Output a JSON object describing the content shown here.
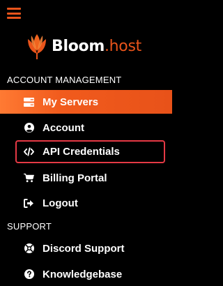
{
  "brand": {
    "name": "Bloom",
    "tld": ".host"
  },
  "colors": {
    "accent": "#e9541b",
    "active_bg": "#f15b1d",
    "highlight_border": "#e53945"
  },
  "sections": {
    "account_management": "ACCOUNT MANAGEMENT",
    "support": "SUPPORT"
  },
  "nav": {
    "my_servers": {
      "label": "My Servers",
      "icon": "server-icon"
    },
    "account": {
      "label": "Account",
      "icon": "user-circle-icon"
    },
    "api_credentials": {
      "label": "API Credentials",
      "icon": "code-icon"
    },
    "billing_portal": {
      "label": "Billing Portal",
      "icon": "shopping-cart-icon"
    },
    "logout": {
      "label": "Logout",
      "icon": "logout-icon"
    },
    "discord_support": {
      "label": "Discord Support",
      "icon": "lifebuoy-icon"
    },
    "knowledgebase": {
      "label": "Knowledgebase",
      "icon": "question-circle-icon"
    }
  }
}
